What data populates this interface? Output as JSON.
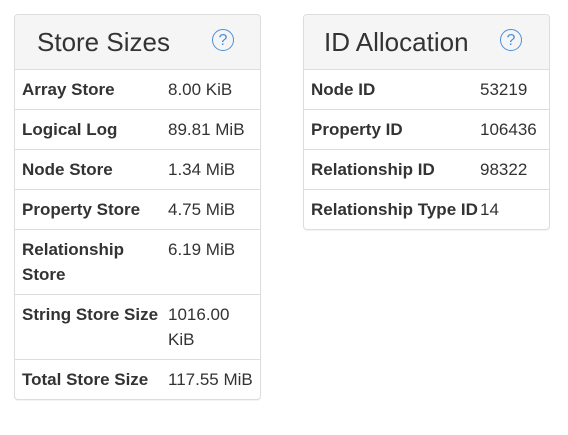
{
  "store_sizes": {
    "title": "Store Sizes",
    "help_icon": "question-circle-icon",
    "rows": [
      {
        "label": "Array Store",
        "value": "8.00 KiB"
      },
      {
        "label": "Logical Log",
        "value": "89.81 MiB"
      },
      {
        "label": "Node Store",
        "value": "1.34 MiB"
      },
      {
        "label": "Property Store",
        "value": "4.75 MiB"
      },
      {
        "label": "Relationship Store",
        "value": "6.19 MiB"
      },
      {
        "label": "String Store Size",
        "value": "1016.00 KiB"
      },
      {
        "label": "Total Store Size",
        "value": "117.55 MiB"
      }
    ]
  },
  "id_allocation": {
    "title": "ID Allocation",
    "help_icon": "question-circle-icon",
    "rows": [
      {
        "label": "Node ID",
        "value": "53219"
      },
      {
        "label": "Property ID",
        "value": "106436"
      },
      {
        "label": "Relationship ID",
        "value": "98322"
      },
      {
        "label": "Relationship Type ID",
        "value": "14"
      }
    ]
  },
  "colors": {
    "accent": "#4a90d9",
    "header_bg": "#f5f5f5",
    "border": "#dddddd"
  }
}
